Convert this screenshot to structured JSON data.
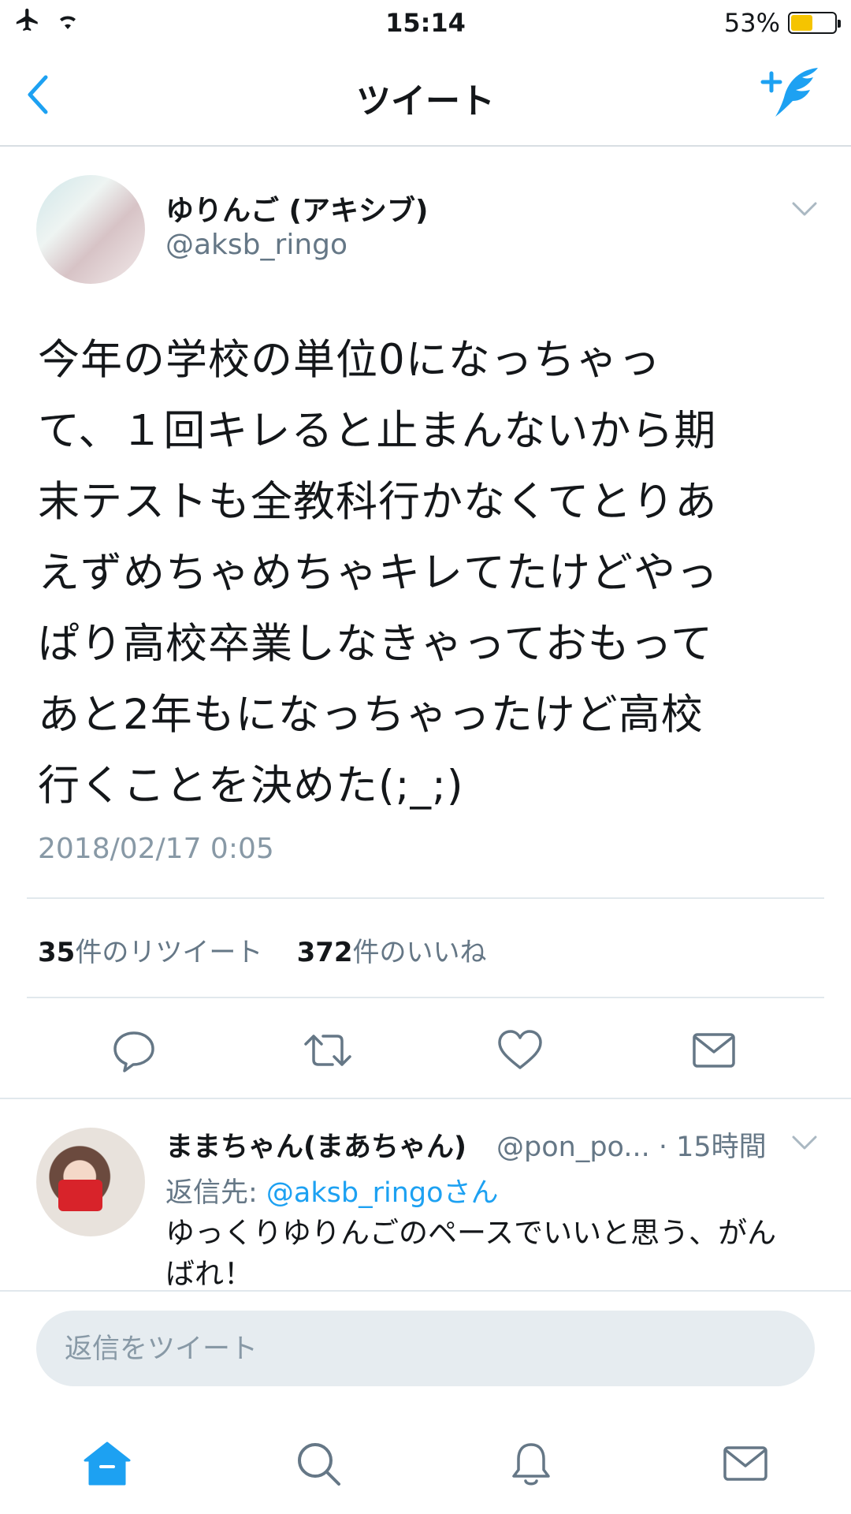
{
  "status_bar": {
    "time": "15:14",
    "battery": "53%",
    "battery_level": 0.53
  },
  "nav": {
    "title": "ツイート"
  },
  "tweet": {
    "display_name": "ゆりんご (アキシブ)",
    "handle": "@aksb_ringo",
    "body_lines": [
      "今年の学校の単位0になっちゃっ",
      "て、１回キレると止まんないから期",
      "末テストも全教科行かなくてとりあ",
      "えずめちゃめちゃキレてたけどやっ",
      "ぱり高校卒業しなきゃっておもって",
      "あと2年もになっちゃったけど高校",
      "行くことを決めた(;_;)"
    ],
    "timestamp": "2018/02/17 0:05",
    "retweet_count": "35",
    "retweet_label": "件のリツイート",
    "like_count": "372",
    "like_label": "件のいいね"
  },
  "reply": {
    "display_name": "ままちゃん(まあちゃん)",
    "handle_time": "@pon_po... · 15時間",
    "reply_to_prefix": "返信先: ",
    "reply_to_handle": "@aksb_ringoさん",
    "text": "ゆっくりゆりんごのペースでいいと思う、がんばれ！"
  },
  "composer": {
    "placeholder": "返信をツイート"
  },
  "colors": {
    "accent": "#1da1f2",
    "secondary_text": "#657786",
    "divider": "#e1e8ed"
  }
}
